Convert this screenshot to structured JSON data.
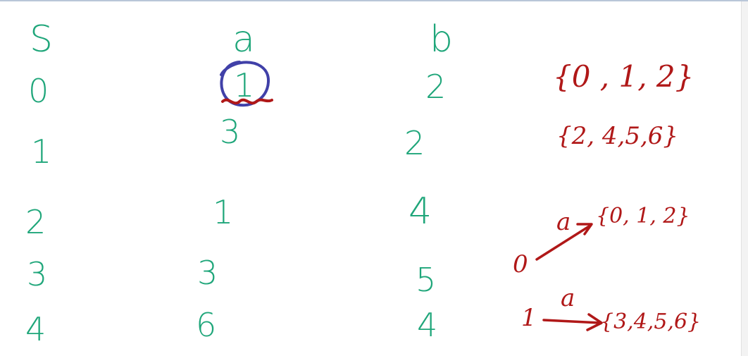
{
  "table": {
    "headers": [
      "S",
      "a",
      "b"
    ],
    "rows": [
      {
        "s": "0",
        "a": "1",
        "b": "2"
      },
      {
        "s": "1",
        "a": "3",
        "b": "2"
      },
      {
        "s": "2",
        "a": "1",
        "b": "4"
      },
      {
        "s": "3",
        "a": "3",
        "b": "5"
      },
      {
        "s": "4",
        "a": "6",
        "b": "4"
      }
    ]
  },
  "notes": {
    "set1": "{0 , 1, 2}",
    "set2": "{2, 4,5,6}",
    "transition1": {
      "from": "0",
      "label": "a",
      "to": "{0, 1, 2}"
    },
    "transition2": {
      "from": "1",
      "label": "a",
      "to": "{3,4,5,6}"
    }
  },
  "colors": {
    "table_ink": "#1fa67a",
    "note_ink": "#b01818",
    "circle_ink": "#4040a8"
  }
}
